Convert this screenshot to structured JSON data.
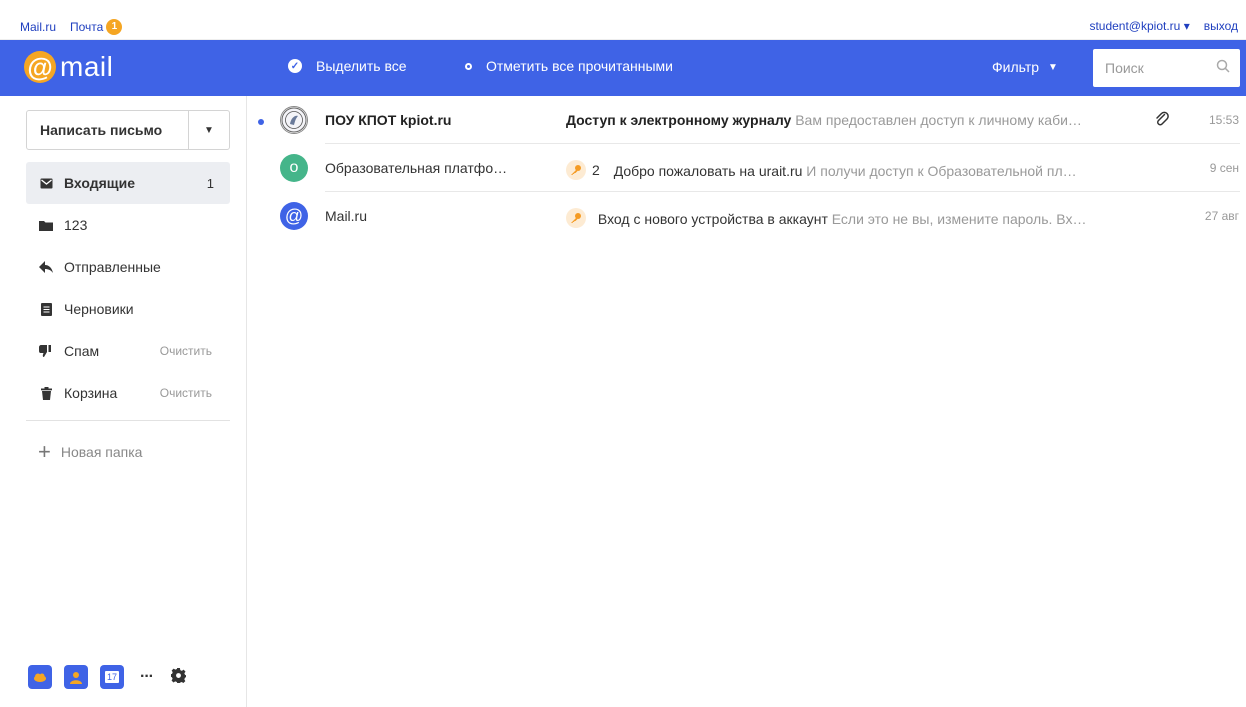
{
  "topbar": {
    "portal_link": "Mail.ru",
    "mail_tab": "Почта",
    "mail_badge": "1",
    "user_email": "student@kpiot.ru",
    "user_caret": "▾",
    "logout": "выход"
  },
  "toolbar": {
    "logo_word": "mail",
    "select_all": "Выделить все",
    "mark_all_read": "Отметить все прочитанными",
    "filter": "Фильтр",
    "filter_caret": "▼",
    "search_placeholder": "Поиск"
  },
  "sidebar": {
    "compose": "Написать письмо",
    "compose_caret": "▼",
    "folders": [
      {
        "label": "Входящие",
        "count": "1",
        "icon": "envelope-icon",
        "active": true
      },
      {
        "label": "123",
        "icon": "folder-icon"
      },
      {
        "label": "Отправленные",
        "icon": "reply-icon"
      },
      {
        "label": "Черновики",
        "icon": "draft-icon"
      },
      {
        "label": "Спам",
        "clear": "Очистить",
        "icon": "thumbs-down-icon"
      },
      {
        "label": "Корзина",
        "clear": "Очистить",
        "icon": "trash-icon"
      }
    ],
    "new_folder": "Новая папка",
    "new_folder_plus": "+",
    "more": "···",
    "calendar_day": "17"
  },
  "messages": [
    {
      "sender": "ПОУ КПОТ kpiot.ru",
      "subject": "Доступ к электронному журналу",
      "snippet": "Вам предоставлен доступ к личному каби…",
      "time": "15:53",
      "unread": true,
      "attachment": true,
      "avatar_icon": "seal-icon"
    },
    {
      "sender": "Образовательная платфо…",
      "thread_count": "2",
      "subject": "Добро пожаловать на urait.ru",
      "snippet": "И получи доступ к Образовательной пл…",
      "time": "9 сен",
      "unread": false,
      "avatar_letter": "о",
      "avatar_color": "#45b58a"
    },
    {
      "sender": "Mail.ru",
      "subject": "Вход с нового устройства в аккаунт",
      "snippet": "Если это не вы, измените пароль. Вх…",
      "time": "27 авг",
      "unread": false,
      "avatar_letter": "@",
      "avatar_color": "#3f63e6"
    }
  ],
  "colors": {
    "accent": "#3f63e6",
    "orange": "#f5a623",
    "green": "#45b58a"
  }
}
